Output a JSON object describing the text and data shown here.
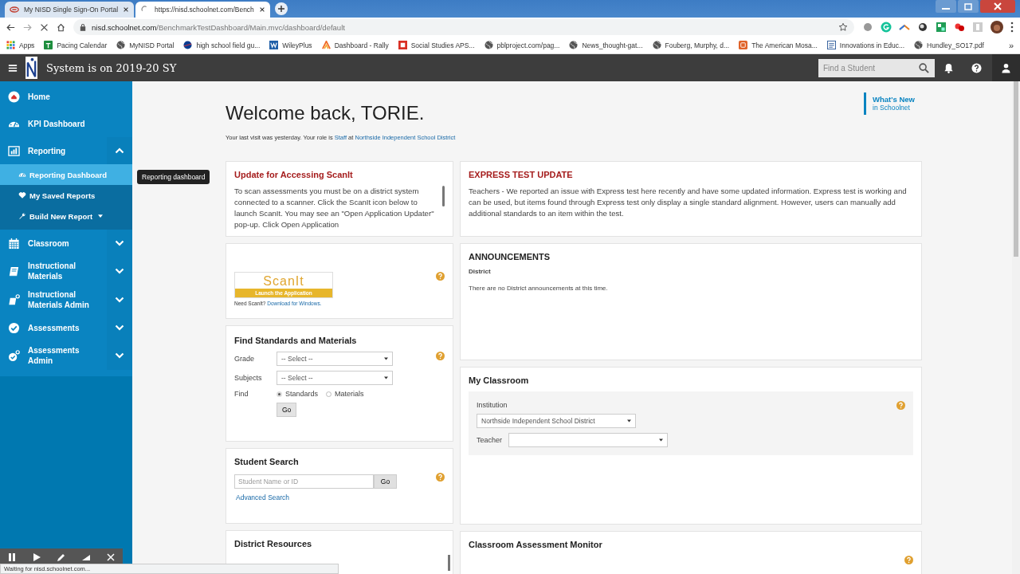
{
  "browser": {
    "tabs": [
      {
        "title": "My NISD Single Sign-On Portal",
        "selected": false,
        "loading": false
      },
      {
        "title": "https://nisd.schoolnet.com/Bench",
        "selected": true,
        "loading": true
      }
    ],
    "url": {
      "host": "nisd.schoolnet.com",
      "path": "/BenchmarkTestDashboard/Main.mvc/dashboard/default"
    },
    "bookmarks": [
      {
        "label": "Apps"
      },
      {
        "label": "Pacing Calendar"
      },
      {
        "label": "MyNISD Portal"
      },
      {
        "label": "high school field gu..."
      },
      {
        "label": "WileyPlus"
      },
      {
        "label": "Dashboard - Rally"
      },
      {
        "label": "Social Studies APS..."
      },
      {
        "label": "pblproject.com/pag..."
      },
      {
        "label": "News_thought-gat..."
      },
      {
        "label": "Fouberg, Murphy, d..."
      },
      {
        "label": "The American Mosa..."
      },
      {
        "label": "Innovations in Educ..."
      },
      {
        "label": "Hundley_SO17.pdf"
      }
    ],
    "bookmarks_overflow": "»",
    "status": "Waiting for nisd.schoolnet.com..."
  },
  "header": {
    "title": "System is on 2019-20 SY",
    "search_placeholder": "Find a Student"
  },
  "sidebar": {
    "items": [
      {
        "label": "Home"
      },
      {
        "label": "KPI Dashboard"
      },
      {
        "label": "Reporting",
        "expanded": true,
        "children": [
          {
            "label": "Reporting Dashboard",
            "selected": true,
            "dropdown": false
          },
          {
            "label": "My Saved Reports",
            "selected": false,
            "dropdown": false
          },
          {
            "label": "Build New Report",
            "selected": false,
            "dropdown": true
          }
        ]
      },
      {
        "label": "Classroom",
        "expanded": false
      },
      {
        "label": "Instructional Materials",
        "expanded": false
      },
      {
        "label": "Instructional Materials Admin",
        "expanded": false
      },
      {
        "label": "Assessments",
        "expanded": false
      },
      {
        "label": "Assessments Admin",
        "expanded": false
      }
    ]
  },
  "tooltip": "Reporting dashboard",
  "welcome": {
    "heading": "Welcome back, TORIE.",
    "text": "Your last visit was yesterday. Your role is",
    "role": "Staff",
    "joiner": "at",
    "institution": "Northside Independent School District"
  },
  "whats_new": {
    "title": "What's New",
    "subtitle": "in Schoolnet"
  },
  "scanit_update": {
    "title": "Update for Accessing ScanIt",
    "text": "To scan assessments you must be on a district system connected to a scanner.  Click the ScanIt icon below to launch ScanIt. You may see an \"Open Application Updater\" pop-up.  Click Open Application"
  },
  "scanit": {
    "logo": "ScanIt",
    "launch": "Launch the Application",
    "need": "Need ScanIt?",
    "download": "Download for Windows."
  },
  "find_standards": {
    "title": "Find Standards and Materials",
    "fields": [
      {
        "label": "Grade",
        "value": "-- Select --"
      },
      {
        "label": "Subjects",
        "value": "-- Select --"
      }
    ],
    "find_label": "Find",
    "options": [
      {
        "label": "Standards",
        "selected": true
      },
      {
        "label": "Materials",
        "selected": false
      }
    ],
    "button": "Go"
  },
  "student_search": {
    "title": "Student Search",
    "placeholder": "Student Name or ID",
    "button": "Go",
    "link": "Advanced Search"
  },
  "district_resources": {
    "title": "District Resources"
  },
  "express_update": {
    "title": "EXPRESS TEST UPDATE",
    "text": "Teachers - We reported an issue with Express test here recently and have some updated information. Express test is working and can be used, but items found through Express test only display a single standard alignment. However, users can manually add additional standards to an item within the test."
  },
  "announcements": {
    "title": "ANNOUNCEMENTS",
    "section": "District",
    "text": "There are no District announcements at this time."
  },
  "my_classroom": {
    "title": "My Classroom",
    "institution_label": "Institution",
    "institution": "Northside Independent School District",
    "teacher_label": "Teacher"
  },
  "assessment_monitor": {
    "title": "Classroom Assessment Monitor"
  }
}
